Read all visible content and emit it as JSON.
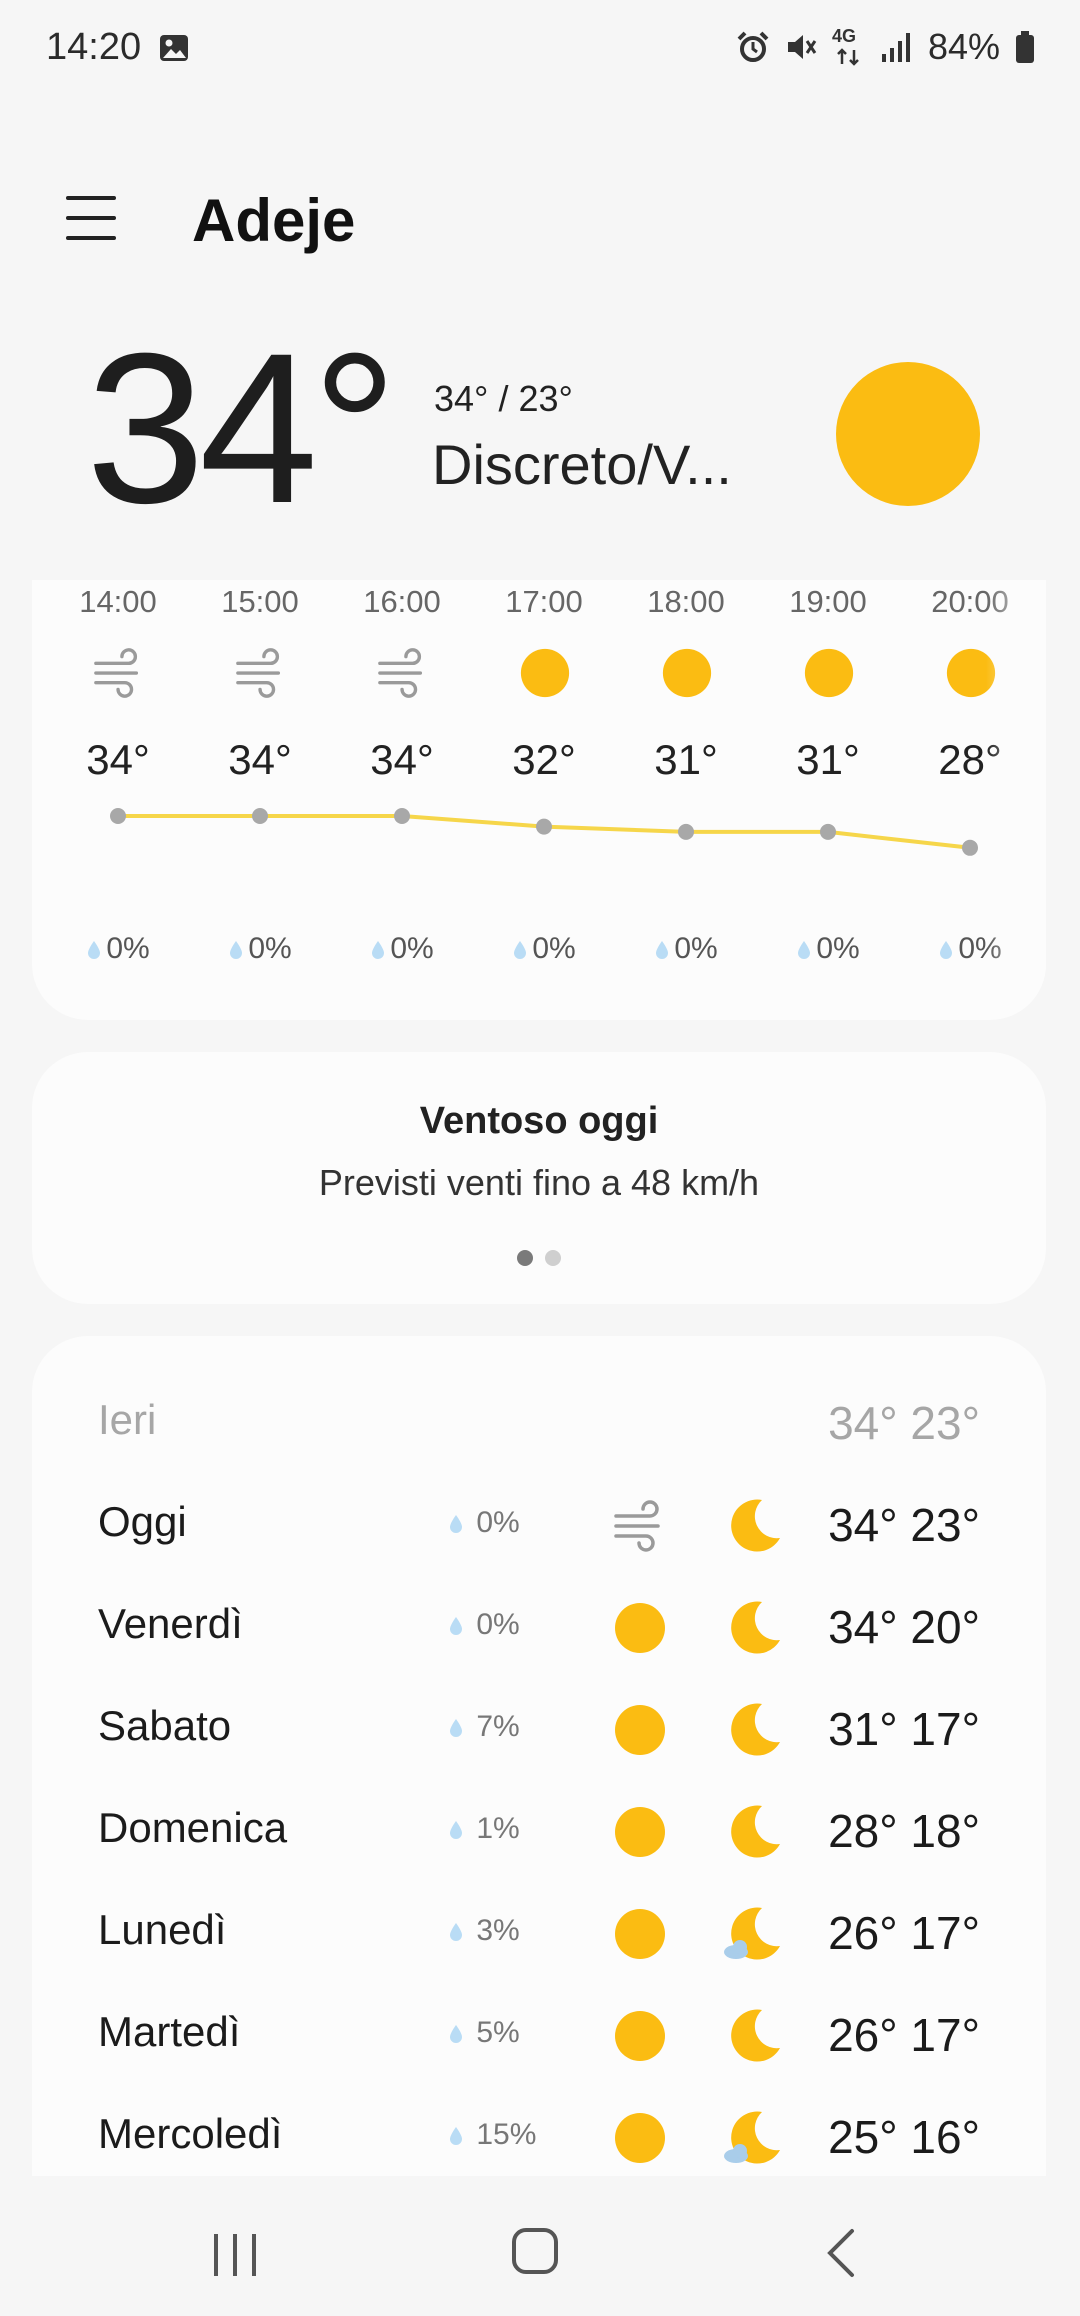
{
  "status_bar": {
    "time": "14:20",
    "network": "4G",
    "battery": "84%"
  },
  "header": {
    "location": "Adeje"
  },
  "current": {
    "temperature": "34°",
    "high_low": "34° / 23°",
    "condition": "Discreto/V..."
  },
  "hourly": [
    {
      "hour": "14:00",
      "icon": "wind-icon",
      "temp": "34°",
      "precip": "0%"
    },
    {
      "hour": "15:00",
      "icon": "wind-icon",
      "temp": "34°",
      "precip": "0%"
    },
    {
      "hour": "16:00",
      "icon": "wind-icon",
      "temp": "34°",
      "precip": "0%"
    },
    {
      "hour": "17:00",
      "icon": "sun-icon",
      "temp": "32°",
      "precip": "0%"
    },
    {
      "hour": "18:00",
      "icon": "sun-icon",
      "temp": "31°",
      "precip": "0%"
    },
    {
      "hour": "19:00",
      "icon": "sun-icon",
      "temp": "31°",
      "precip": "0%"
    },
    {
      "hour": "20:00",
      "icon": "sun-icon",
      "temp": "28°",
      "precip": "0%"
    }
  ],
  "alert": {
    "title": "Ventoso oggi",
    "message": "Previsti venti fino a 48 km/h",
    "page_count": 2,
    "active_page": 1
  },
  "daily": [
    {
      "day": "Ieri",
      "precip": "",
      "day_icon": "",
      "night_icon": "",
      "temps": "34° 23°",
      "muted": true
    },
    {
      "day": "Oggi",
      "precip": "0%",
      "day_icon": "wind-icon",
      "night_icon": "moon-icon",
      "temps": "34° 23°"
    },
    {
      "day": "Venerdì",
      "precip": "0%",
      "day_icon": "sun-icon",
      "night_icon": "moon-icon",
      "temps": "34° 20°"
    },
    {
      "day": "Sabato",
      "precip": "7%",
      "day_icon": "sun-icon",
      "night_icon": "moon-icon",
      "temps": "31° 17°"
    },
    {
      "day": "Domenica",
      "precip": "1%",
      "day_icon": "sun-icon",
      "night_icon": "moon-icon",
      "temps": "28° 18°"
    },
    {
      "day": "Lunedì",
      "precip": "3%",
      "day_icon": "sun-icon",
      "night_icon": "moon-cloud-icon",
      "temps": "26° 17°"
    },
    {
      "day": "Martedì",
      "precip": "5%",
      "day_icon": "sun-icon",
      "night_icon": "moon-icon",
      "temps": "26° 17°"
    },
    {
      "day": "Mercoledì",
      "precip": "15%",
      "day_icon": "sun-icon",
      "night_icon": "moon-cloud-icon",
      "temps": "25° 16°"
    }
  ],
  "colors": {
    "sun": "#fbbc12",
    "temp_line": "#f6d64a",
    "drop": "#b9dcf5"
  }
}
